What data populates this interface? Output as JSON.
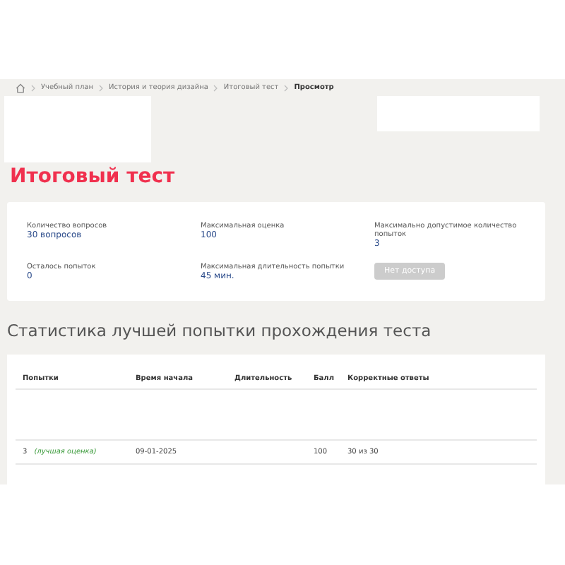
{
  "breadcrumb": {
    "items": [
      {
        "label": "Учебный план",
        "current": false
      },
      {
        "label": "История и теория дизайна",
        "current": false
      },
      {
        "label": "Итоговый тест",
        "current": false
      },
      {
        "label": "Просмотр",
        "current": true
      }
    ]
  },
  "page_title": "Итоговый тест",
  "info": [
    {
      "label": "Количество вопросов",
      "value": "30 вопросов"
    },
    {
      "label": "Максимальная оценка",
      "value": "100"
    },
    {
      "label": "Максимально допустимое количество попыток",
      "value": "3"
    },
    {
      "label": "Осталось попыток",
      "value": "0"
    },
    {
      "label": "Максимальная длительность попытки",
      "value": "45 мин."
    }
  ],
  "access_button": {
    "label": "Нет доступа",
    "disabled": true
  },
  "stats_title": "Статистика лучшей попытки прохождения теста",
  "table": {
    "columns": [
      "Попытки",
      "Время начала",
      "Длительность",
      "Балл",
      "Корректные ответы"
    ],
    "rows": [
      {
        "attempt": "3",
        "note": "(лучшая оценка)",
        "start": "09-01-2025",
        "score": "100",
        "correct": "30 из 30"
      }
    ]
  }
}
